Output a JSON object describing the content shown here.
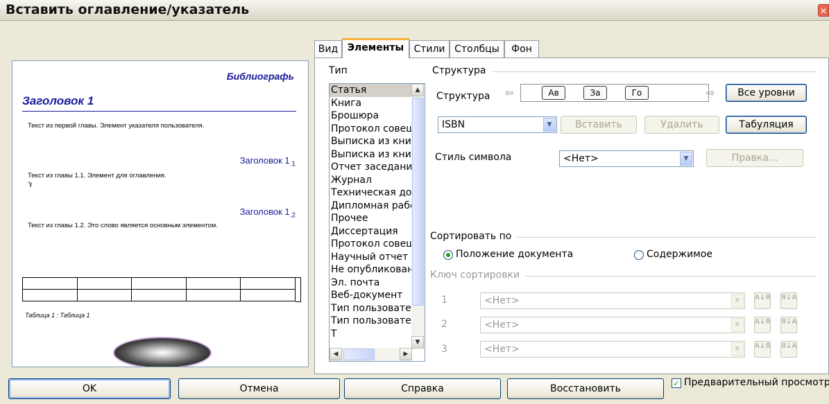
{
  "window": {
    "title": "Вставить оглавление/указатель",
    "close_glyph": "✕"
  },
  "preview": {
    "bibliography_title": "Библиографь",
    "heading1": "Заголовок 1",
    "text1": "Текст из первой главы. Элемент указателя пользователя.",
    "heading11": "Заголовок 1",
    "heading11_sub": ".1",
    "text2": "Текст из главы 1.1. Элемент для оглавления.",
    "text2_mark": "ℽ",
    "heading12": "Заголовок 1",
    "heading12_sub": ".2",
    "text3": "Текст из главы 1.2. Это слово является основным элементом.",
    "caption": "Таблица 1 : Таблица 1"
  },
  "tabs": [
    {
      "label": "Вид",
      "active": false
    },
    {
      "label": "Элементы",
      "active": true
    },
    {
      "label": "Стили",
      "active": false
    },
    {
      "label": "Столбцы",
      "active": false
    },
    {
      "label": "Фон",
      "active": false
    }
  ],
  "type_section": {
    "label": "Тип",
    "items": [
      "Статья",
      "Книга",
      "Брошюра",
      "Протокол совещ",
      "Выписка из кни",
      "Выписка из кни",
      "Отчет заседани",
      "Журнал",
      "Техническая до",
      "Дипломная рабо",
      "Прочее",
      "Диссертация",
      "Протокол совещ",
      "Научный отчет",
      "Не опубликован",
      "Эл. почта",
      "Веб-документ",
      "Тип пользовате",
      "Тип пользовате",
      "Т"
    ],
    "selected_index": 0
  },
  "structure": {
    "group_label": "Структура",
    "row_label": "Структура",
    "tokens": [
      "Ав",
      "За",
      "Го"
    ],
    "all_levels_button": "Все уровни",
    "field_combo_value": "ISBN",
    "insert_button": "Вставить",
    "delete_button": "Удалить",
    "tab_button": "Табуляция",
    "char_style_label": "Стиль символа",
    "char_style_value": "<Нет>",
    "edit_button": "Правка..."
  },
  "sort": {
    "group_label": "Сортировать по",
    "option_position": "Положение документа",
    "option_content": "Содержимое",
    "selected": "position",
    "keys_label": "Ключ сортировки",
    "keys": [
      {
        "num": "1",
        "value": "<Нет>"
      },
      {
        "num": "2",
        "value": "<Нет>"
      },
      {
        "num": "3",
        "value": "<Нет>"
      }
    ],
    "asc_glyph": "А↓Я",
    "desc_glyph": "Я↓А"
  },
  "footer": {
    "ok": "OK",
    "cancel": "Отмена",
    "help": "Справка",
    "restore": "Восстановить",
    "preview_label": "Предварительный просмотр",
    "preview_checked": true,
    "check_glyph": "✓"
  },
  "colors": {
    "accent_tab": "#f5b33c",
    "preview_heading": "#1a1a9c",
    "radio_dot": "#21a121"
  }
}
